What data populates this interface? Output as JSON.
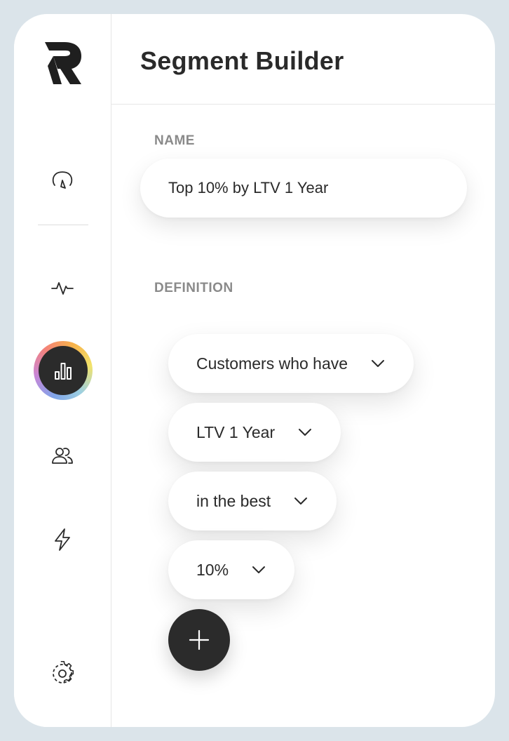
{
  "header": {
    "title": "Segment Builder"
  },
  "sidebar": {
    "items": [
      {
        "name": "dashboard",
        "icon": "gauge-icon"
      },
      {
        "name": "activity",
        "icon": "pulse-icon"
      },
      {
        "name": "analytics",
        "icon": "bar-chart-icon",
        "active": true
      },
      {
        "name": "users",
        "icon": "users-icon"
      },
      {
        "name": "automations",
        "icon": "lightning-icon"
      },
      {
        "name": "settings",
        "icon": "gear-icon"
      }
    ],
    "active_ring_colors": [
      "#7fa4ea",
      "#c985d6",
      "#f4827a",
      "#f7b14a",
      "#f2e36a"
    ]
  },
  "form": {
    "name_label": "NAME",
    "name_value": "Top 10% by LTV 1 Year",
    "definition_label": "DEFINITION",
    "definition": [
      {
        "value": "Customers who have"
      },
      {
        "value": "LTV 1 Year"
      },
      {
        "value": "in the best"
      },
      {
        "value": "10%"
      }
    ]
  },
  "colors": {
    "dark": "#2b2b2b",
    "background": "#dbe4ea"
  }
}
